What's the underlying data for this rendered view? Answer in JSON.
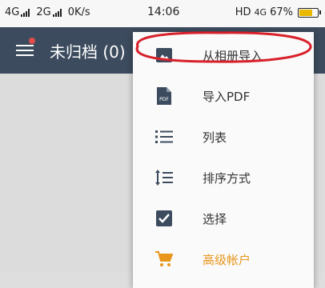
{
  "status_bar": {
    "network1": "4G",
    "network2": "2G",
    "speed": "0K/s",
    "time": "14:06",
    "hd": "HD",
    "network3": "4G",
    "battery": "67%",
    "battery_level": 0.67,
    "battery_color": "#e9b800"
  },
  "app_bar": {
    "title": "未归档 (0)",
    "menu_icon": "hamburger-icon",
    "bg_color": "#3c4c5e"
  },
  "dropdown": {
    "items": [
      {
        "label": "从相册导入",
        "icon": "image-icon"
      },
      {
        "label": "导入PDF",
        "icon": "pdf-file-icon"
      },
      {
        "label": "列表",
        "icon": "list-icon"
      },
      {
        "label": "排序方式",
        "icon": "sort-icon"
      },
      {
        "label": "选择",
        "icon": "checkbox-icon"
      },
      {
        "label": "高级帐户",
        "icon": "cart-icon"
      }
    ],
    "premium_color": "#e8961c",
    "highlight_color": "#d8202a"
  }
}
